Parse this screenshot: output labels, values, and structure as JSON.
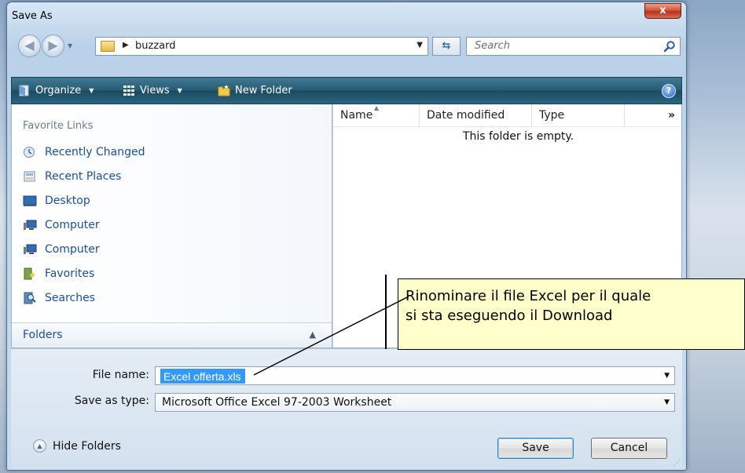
{
  "window": {
    "title": "Save As",
    "close_label": "x"
  },
  "address": {
    "path": "buzzard",
    "search_placeholder": "Search"
  },
  "toolbar": {
    "organize": "Organize",
    "views": "Views",
    "new_folder": "New Folder"
  },
  "sidebar": {
    "section_title": "Favorite Links",
    "items": [
      {
        "label": "Recently Changed",
        "icon": "recently-changed-icon"
      },
      {
        "label": "Recent Places",
        "icon": "recent-places-icon"
      },
      {
        "label": "Desktop",
        "icon": "desktop-icon"
      },
      {
        "label": "Computer",
        "icon": "computer-icon"
      },
      {
        "label": "Computer",
        "icon": "computer-icon"
      },
      {
        "label": "Favorites",
        "icon": "favorites-icon"
      },
      {
        "label": "Searches",
        "icon": "searches-icon"
      }
    ],
    "folders_label": "Folders"
  },
  "file_list": {
    "columns": [
      "Name",
      "Date modified",
      "Type"
    ],
    "more": "»",
    "empty_message": "This folder is empty."
  },
  "form": {
    "file_name_label": "File name:",
    "file_name_value": "Excel offerta.xls",
    "save_type_label": "Save as type:",
    "save_type_value": "Microsoft Office Excel 97-2003 Worksheet",
    "hide_folders": "Hide Folders",
    "save": "Save",
    "cancel": "Cancel"
  },
  "annotation": {
    "line1": "Rinominare il file Excel per il quale",
    "line2": "si sta eseguendo il Download"
  },
  "colors": {
    "toolbar": "#275a72",
    "link": "#1a4f9c",
    "selection": "#3399ff",
    "callout": "#ffffcc",
    "close": "#c8402a"
  }
}
